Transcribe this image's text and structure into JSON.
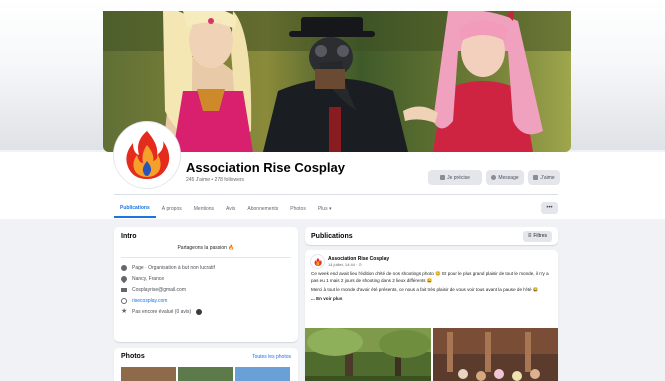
{
  "page": {
    "name": "Association Rise Cosplay",
    "stats": "245 J'aime • 278 followers"
  },
  "actions": {
    "like": "Je précise",
    "message": "Message",
    "more": "J'aime"
  },
  "tabs": [
    "Publications",
    "À propos",
    "Mentions",
    "Avis",
    "Abonnements",
    "Photos",
    "Plus ▾"
  ],
  "more_button": "•••",
  "intro": {
    "title": "Intro",
    "tagline": "Partageons la passion 🔥",
    "rows": [
      {
        "icon": "info-icon",
        "text": "Page · Organisation à but non lucratif"
      },
      {
        "icon": "location-icon",
        "text": "Nancy, France"
      },
      {
        "icon": "mail-icon",
        "text": "Cosplayrise@gmail.com"
      },
      {
        "icon": "link-icon",
        "text": "risecosplay.com"
      },
      {
        "icon": "star-icon",
        "text": "Pas encore évalué (0 avis)"
      }
    ]
  },
  "photos": {
    "title": "Photos",
    "see_all": "Toutes les photos"
  },
  "publications": {
    "title": "Publications",
    "filter": "Filtres",
    "post": {
      "author": "Association Rise Cosplay",
      "date": "14 juillet, 14:44 · ⊙",
      "paragraph1": "Ce week end avait lieu l'édition d'été de nos shootings photo 😊 Et pour le plus grand plaisir de tout le monde, il n'y a pas eu 1 mais 2 jours de shooting dans 2 lieux différents 😄",
      "paragraph2": "Merci à tout le monde d'avoir été présents, ce nous a fait très plaisir de vous voir tous avant la pause de l'été 😄",
      "see_more": "... En voir plus"
    }
  },
  "colors": {
    "accent": "#1b74e4",
    "background": "#f0f2f5",
    "card": "#ffffff"
  }
}
